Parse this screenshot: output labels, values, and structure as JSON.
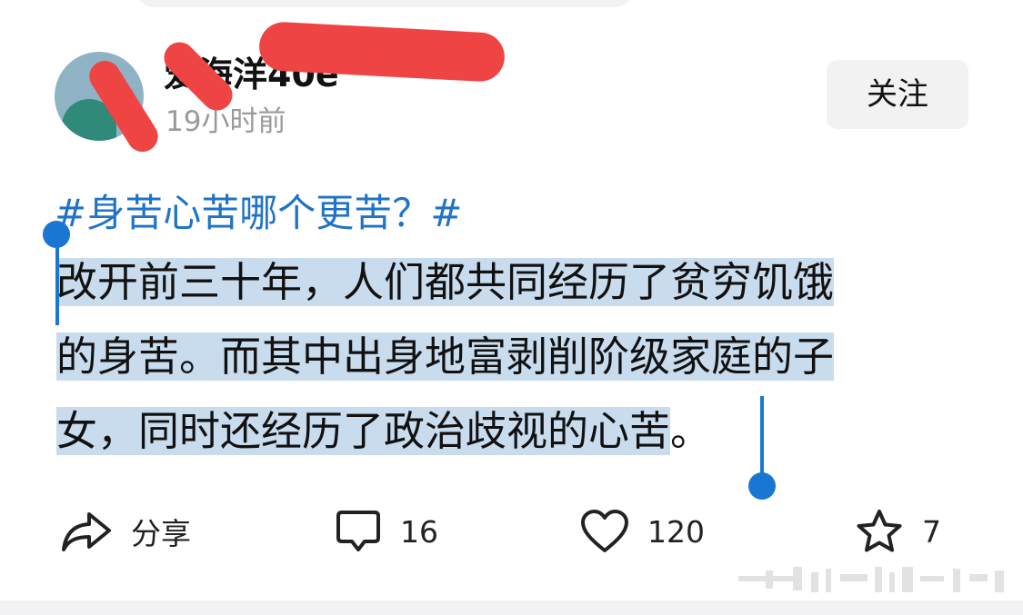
{
  "post": {
    "author": {
      "name": "爱海洋40e",
      "time": "19小时前"
    },
    "follow_label": "关注",
    "hashtag": "#身苦心苦哪个更苦？#",
    "body_lines": [
      "改开前三十年，人们都共同经历了贫穷饥饿",
      "的身苦。而其中出身地富剥削阶级家庭的子",
      "女，同时还经历了政治歧视的心苦"
    ],
    "body_tail": "。"
  },
  "actions": {
    "share": {
      "label": "分享",
      "icon": "share-arrow-icon"
    },
    "comment": {
      "count": "16",
      "icon": "comment-bubble-icon"
    },
    "like": {
      "count": "120",
      "icon": "heart-icon"
    },
    "favorite": {
      "count": "7",
      "icon": "star-icon"
    }
  },
  "colors": {
    "hashtag": "#1f73c8",
    "selection": "#c9dcee",
    "handle": "#1976d2",
    "redaction": "#ef4444",
    "follow_bg": "#f2f2f2"
  }
}
